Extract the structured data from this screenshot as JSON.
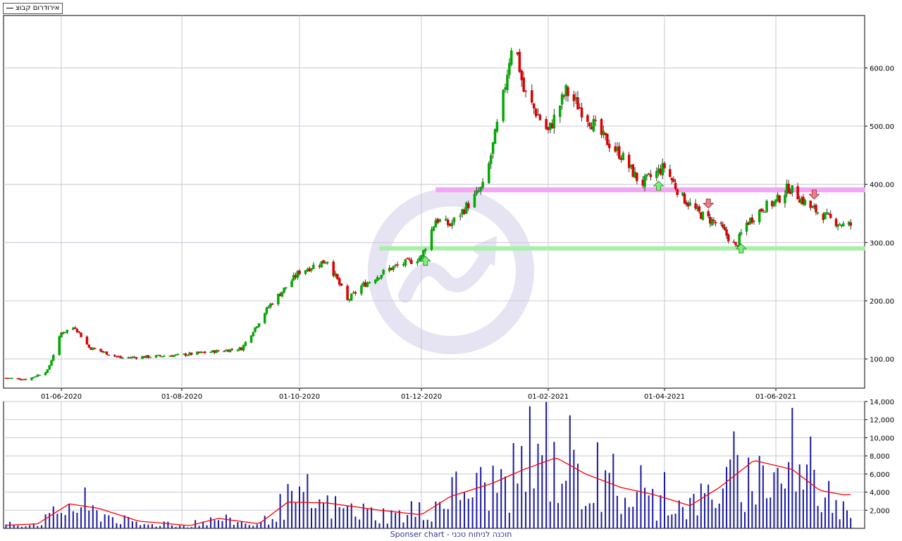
{
  "legend": {
    "label": "אירודרום קבוצ"
  },
  "footer": {
    "text": "Sponser chart - תוכנה לניתוח טכני"
  },
  "colors": {
    "up": "#00aa00",
    "down": "#dd0000",
    "grid": "#c8c8d8",
    "resistance": "#f3a6f3",
    "support": "#a8f0a8",
    "volume_bar": "#1a1aa0",
    "volume_ma": "#ff0000",
    "arrow_up": "#7cf07c",
    "arrow_down": "#f07c8c",
    "watermark": "#e6e3f3"
  },
  "chart_data": [
    {
      "type": "candlestick",
      "title": "",
      "x_ticks": [
        "01-06-2020",
        "01-08-2020",
        "01-10-2020",
        "01-12-2020",
        "01-02-2021",
        "01-04-2021",
        "01-06-2021"
      ],
      "y_ticks": [
        "100.00",
        "200.00",
        "300.00",
        "400.00",
        "500.00",
        "600.00"
      ],
      "ylim": [
        50,
        690
      ],
      "grid": true,
      "dates": [
        "2020-05-01",
        "2020-05-15",
        "2020-05-25",
        "2020-06-01",
        "2020-06-08",
        "2020-06-15",
        "2020-07-01",
        "2020-07-15",
        "2020-08-01",
        "2020-08-15",
        "2020-09-01",
        "2020-09-15",
        "2020-10-01",
        "2020-10-15",
        "2020-10-25",
        "2020-11-01",
        "2020-11-15",
        "2020-12-01",
        "2020-12-08",
        "2020-12-15",
        "2020-12-25",
        "2021-01-01",
        "2021-01-10",
        "2021-01-15",
        "2021-01-20",
        "2021-01-25",
        "2021-02-01",
        "2021-02-10",
        "2021-02-20",
        "2021-03-01",
        "2021-03-10",
        "2021-03-20",
        "2021-04-01",
        "2021-04-10",
        "2021-04-20",
        "2021-05-01",
        "2021-05-10",
        "2021-05-15",
        "2021-05-25",
        "2021-06-01",
        "2021-06-08",
        "2021-06-20",
        "2021-07-01",
        "2021-07-08"
      ],
      "close": [
        68,
        65,
        80,
        145,
        155,
        120,
        102,
        104,
        107,
        112,
        118,
        190,
        250,
        270,
        200,
        225,
        255,
        275,
        340,
        330,
        370,
        400,
        550,
        660,
        560,
        530,
        490,
        560,
        520,
        480,
        450,
        400,
        430,
        380,
        350,
        330,
        292,
        330,
        360,
        370,
        395,
        360,
        340,
        330
      ],
      "resistance_level": 390,
      "support_level": 290,
      "signals": [
        {
          "type": "buy",
          "date": "2020-12-03"
        },
        {
          "type": "buy",
          "date": "2021-03-29"
        },
        {
          "type": "buy",
          "date": "2021-05-13"
        },
        {
          "type": "sell",
          "date": "2021-04-25"
        },
        {
          "type": "sell",
          "date": "2021-06-22"
        }
      ]
    },
    {
      "type": "bar",
      "series": [
        {
          "values_desc": "volume"
        }
      ],
      "y_ticks": [
        "2,000",
        "4,000",
        "6,000",
        "8,000",
        "10,000",
        "12,000",
        "14,000"
      ],
      "ylim": [
        0,
        14000
      ],
      "grid": true,
      "dates": [
        "2020-05-01",
        "2020-05-20",
        "2020-06-05",
        "2020-06-20",
        "2020-07-10",
        "2020-08-05",
        "2020-08-20",
        "2020-09-10",
        "2020-09-25",
        "2020-10-15",
        "2020-11-10",
        "2020-12-01",
        "2020-12-15",
        "2021-01-05",
        "2021-01-20",
        "2021-02-05",
        "2021-02-20",
        "2021-03-10",
        "2021-03-25",
        "2021-04-15",
        "2021-05-01",
        "2021-05-20",
        "2021-06-10",
        "2021-06-25",
        "2021-07-08"
      ],
      "volume_level": [
        300,
        600,
        2800,
        2000,
        500,
        300,
        1200,
        400,
        3500,
        2800,
        1800,
        1500,
        4500,
        5500,
        7000,
        7500,
        5500,
        4000,
        3500,
        2800,
        5000,
        6500,
        7000,
        4500,
        3500
      ],
      "ma_values": [
        300,
        500,
        2700,
        2200,
        800,
        300,
        1100,
        500,
        2900,
        2800,
        2000,
        1500,
        3500,
        5000,
        6500,
        7800,
        6000,
        4500,
        3800,
        2500,
        4500,
        7500,
        6500,
        4200,
        3700
      ]
    }
  ]
}
